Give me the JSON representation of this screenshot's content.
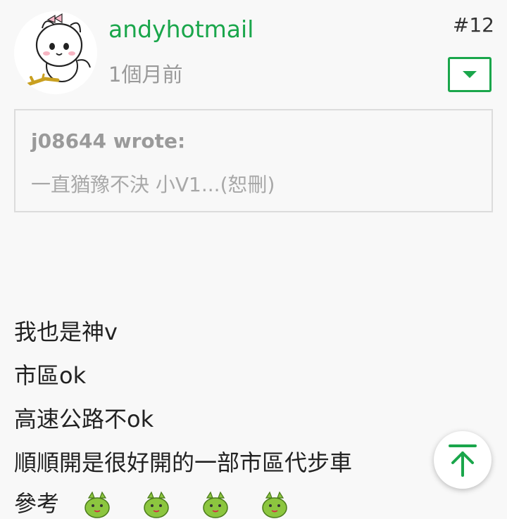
{
  "post": {
    "username": "andyhotmail",
    "post_number": "#12",
    "time": "1個月前"
  },
  "quote": {
    "author": "j08644 wrote:",
    "text": "一直猶豫不決 小V1...(恕刪)"
  },
  "body": {
    "lines": [
      "我也是神v",
      "市區ok",
      "高速公路不ok",
      "順順開是很好開的一部市區代步車"
    ],
    "last_line": "參考"
  },
  "icons": {
    "avatar": "cartoon-mascot-avatar",
    "dropdown": "caret-down-icon",
    "back_to_top": "arrow-up-icon",
    "emoji": "green-blob-emoji-icon"
  },
  "colors": {
    "accent": "#1aa64b",
    "muted": "#9a9a9a",
    "text": "#222222",
    "background": "#f8f8f8"
  }
}
